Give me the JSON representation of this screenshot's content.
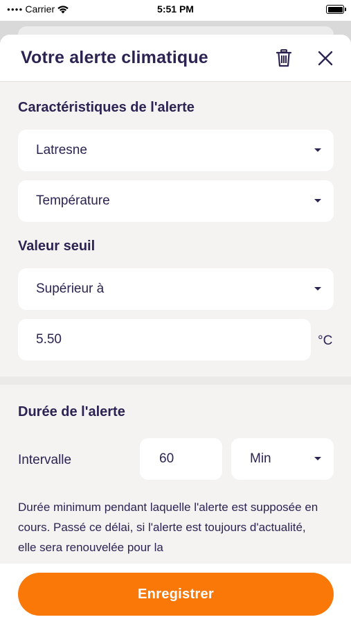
{
  "status_bar": {
    "carrier": "Carrier",
    "time": "5:51 PM"
  },
  "header": {
    "title": "Votre alerte climatique"
  },
  "characteristics": {
    "title": "Caractéristiques de l'alerte",
    "location": "Latresne",
    "metric": "Température"
  },
  "threshold": {
    "title": "Valeur seuil",
    "comparator": "Supérieur à",
    "value": "5.50",
    "unit": "°C"
  },
  "duration": {
    "title": "Durée de l'alerte",
    "interval_label": "Intervalle",
    "interval_value": "60",
    "interval_unit": "Min",
    "description": "Durée minimum pendant laquelle l'alerte est supposée en cours. Passé ce délai, si l'alerte est toujours d'actualité, elle sera renouvelée pour la"
  },
  "footer": {
    "save_label": "Enregistrer"
  },
  "colors": {
    "accent": "#f97808",
    "text": "#2c2352",
    "background": "#f4f3f2"
  }
}
